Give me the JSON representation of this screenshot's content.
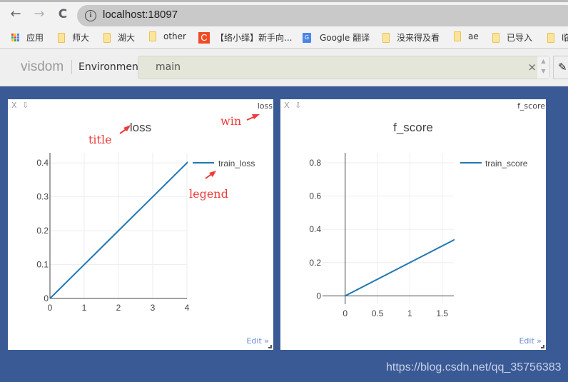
{
  "browser": {
    "url": "localhost:18097",
    "nav": {
      "back": "←",
      "forward": "→",
      "reload": "C",
      "info": "i"
    },
    "bookmarks": [
      {
        "label": "应用",
        "icon": "apps-grid-icon"
      },
      {
        "label": "师大",
        "icon": "folder-icon"
      },
      {
        "label": "湖大",
        "icon": "folder-icon"
      },
      {
        "label": "other",
        "icon": "folder-icon"
      },
      {
        "label": "【络小绎】新手向...",
        "icon": "csdn-icon"
      },
      {
        "label": "Google 翻译",
        "icon": "google-translate-icon"
      },
      {
        "label": "没来得及看",
        "icon": "folder-icon"
      },
      {
        "label": "ae",
        "icon": "folder-icon"
      },
      {
        "label": "已导入",
        "icon": "folder-icon"
      },
      {
        "label": "临",
        "icon": "folder-icon"
      }
    ]
  },
  "visdom": {
    "brand": "visdom",
    "environment_label": "Environment",
    "environment_value": "main",
    "clear_glyph": "×",
    "spin_up": "▲",
    "spin_down": "▼",
    "eraser_glyph": "✎"
  },
  "panes": [
    {
      "close": "X",
      "download": "⇩",
      "win": "loss",
      "edit": "Edit »",
      "annotations": {
        "title": "title",
        "win": "win",
        "legend": "legend"
      }
    },
    {
      "close": "X",
      "download": "⇩",
      "win": "f_score",
      "edit": "Edit »"
    }
  ],
  "chart_data": [
    {
      "type": "line",
      "title": "loss",
      "xlabel": "",
      "ylabel": "",
      "xlim": [
        0,
        4
      ],
      "ylim": [
        0,
        0.43
      ],
      "xticks": [
        0,
        1,
        2,
        3,
        4
      ],
      "xtick_labels": [
        "0",
        "1",
        "2",
        "3",
        "4"
      ],
      "yticks": [
        0,
        0.1,
        0.2,
        0.3,
        0.4
      ],
      "ytick_labels": [
        "0",
        "0.1",
        "0.2",
        "0.3",
        "0.4"
      ],
      "grid": true,
      "legend": "right",
      "series": [
        {
          "name": "train_loss",
          "color": "#1f77b4",
          "x": [
            0,
            1,
            2,
            3,
            4,
            4.1
          ],
          "y": [
            0,
            0.1,
            0.2,
            0.3,
            0.4,
            0.41
          ]
        }
      ]
    },
    {
      "type": "line",
      "title": "f_score",
      "xlabel": "",
      "ylabel": "",
      "xlim": [
        -0.35,
        1.68
      ],
      "ylim": [
        -0.05,
        0.86
      ],
      "xticks": [
        0,
        0.5,
        1,
        1.5
      ],
      "xtick_labels": [
        "0",
        "0.5",
        "1",
        "1.5"
      ],
      "yticks": [
        0,
        0.2,
        0.4,
        0.6,
        0.8
      ],
      "ytick_labels": [
        "0",
        "0.2",
        "0.4",
        "0.6",
        "0.8"
      ],
      "grid": true,
      "legend": "right",
      "series": [
        {
          "name": "train_score",
          "color": "#1f77b4",
          "x": [
            0,
            1,
            2
          ],
          "y": [
            0,
            0.2,
            0.4
          ]
        }
      ]
    }
  ],
  "watermark": "https://blog.csdn.net/qq_35756383"
}
